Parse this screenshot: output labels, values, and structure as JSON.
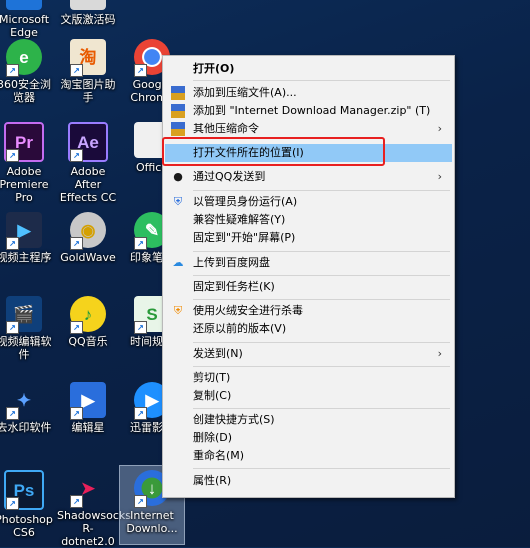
{
  "desktop_icons": [
    {
      "id": "edge",
      "label": "Microsoft Edge"
    },
    {
      "id": "activate",
      "label": "文版激活码"
    },
    {
      "id": "360",
      "label": "360安全浏览器"
    },
    {
      "id": "taobao",
      "label": "淘宝图片助手"
    },
    {
      "id": "chrome",
      "label": "Google Chrome"
    },
    {
      "id": "premiere",
      "label": "Adobe Premiere Pro"
    },
    {
      "id": "aftereffects",
      "label": "Adobe After Effects CC"
    },
    {
      "id": "office",
      "label": "Office"
    },
    {
      "id": "videomaster",
      "label": "视频主程序"
    },
    {
      "id": "goldwave",
      "label": "GoldWave"
    },
    {
      "id": "yinxiang",
      "label": "印象笔记"
    },
    {
      "id": "videoedit",
      "label": "视频编辑软件"
    },
    {
      "id": "qqmusic",
      "label": "QQ音乐"
    },
    {
      "id": "timeplan",
      "label": "时间规划"
    },
    {
      "id": "watermark",
      "label": "去水印软件"
    },
    {
      "id": "editstar",
      "label": "编辑星"
    },
    {
      "id": "xunlei",
      "label": "迅雷影音"
    },
    {
      "id": "photoshop",
      "label": "Photoshop CS6"
    },
    {
      "id": "shadowsocks",
      "label": "Shadowsocks R-dotnet2.0"
    },
    {
      "id": "idm",
      "label": "Internet Downlo..."
    }
  ],
  "context_menu": {
    "open": "打开(O)",
    "add_archive": "添加到压缩文件(A)...",
    "add_zip": "添加到 \"Internet Download Manager.zip\" (T)",
    "other_compress": "其他压缩命令",
    "open_location": "打开文件所在的位置(I)",
    "send_qq": "通过QQ发送到",
    "run_admin": "以管理员身份运行(A)",
    "compat": "兼容性疑难解答(Y)",
    "pin_start": "固定到\"开始\"屏幕(P)",
    "baidu": "上传到百度网盘",
    "pin_taskbar": "固定到任务栏(K)",
    "huorong": "使用火绒安全进行杀毒",
    "restore": "还原以前的版本(V)",
    "send_to": "发送到(N)",
    "cut": "剪切(T)",
    "copy": "复制(C)",
    "shortcut": "创建快捷方式(S)",
    "delete": "删除(D)",
    "rename": "重命名(M)",
    "properties": "属性(R)"
  },
  "colors": {
    "highlight": "#91c9f7",
    "annotation_red": "#e82020"
  }
}
